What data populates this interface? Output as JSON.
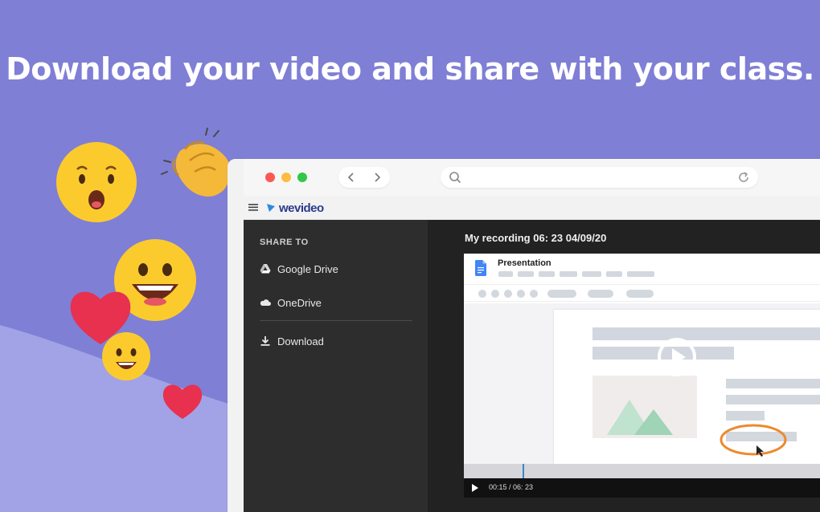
{
  "headline": "Download your video and share with your class.",
  "colors": {
    "background": "#7f7fd6",
    "wave": "#a1a3e6",
    "panel_dark": "#2d2d2d",
    "main_dark": "#222222",
    "annotation": "#ec8a2e",
    "scrub_marker": "#3a86c8"
  },
  "emojis": [
    "surprised-face-emoji",
    "clapping-hands-emoji",
    "grinning-face-emoji",
    "red-heart-emoji",
    "smiling-face-emoji",
    "small-heart-emoji"
  ],
  "browser": {
    "nav_icons": [
      "chevron-left-icon",
      "chevron-right-icon"
    ],
    "address_icons": [
      "search-icon",
      "reload-icon"
    ]
  },
  "app": {
    "logo_text": "wevideo",
    "sidebar": {
      "title": "SHARE TO",
      "items": [
        {
          "label": "Google Drive",
          "icon": "google-drive-icon"
        },
        {
          "label": "OneDrive",
          "icon": "cloud-icon"
        },
        {
          "label": "Download",
          "icon": "download-icon"
        }
      ]
    },
    "recording": {
      "title": "My recording 06: 23 04/09/20",
      "document_title": "Presentation",
      "time": "00:15 / 06: 23",
      "progress": 0.04
    }
  }
}
